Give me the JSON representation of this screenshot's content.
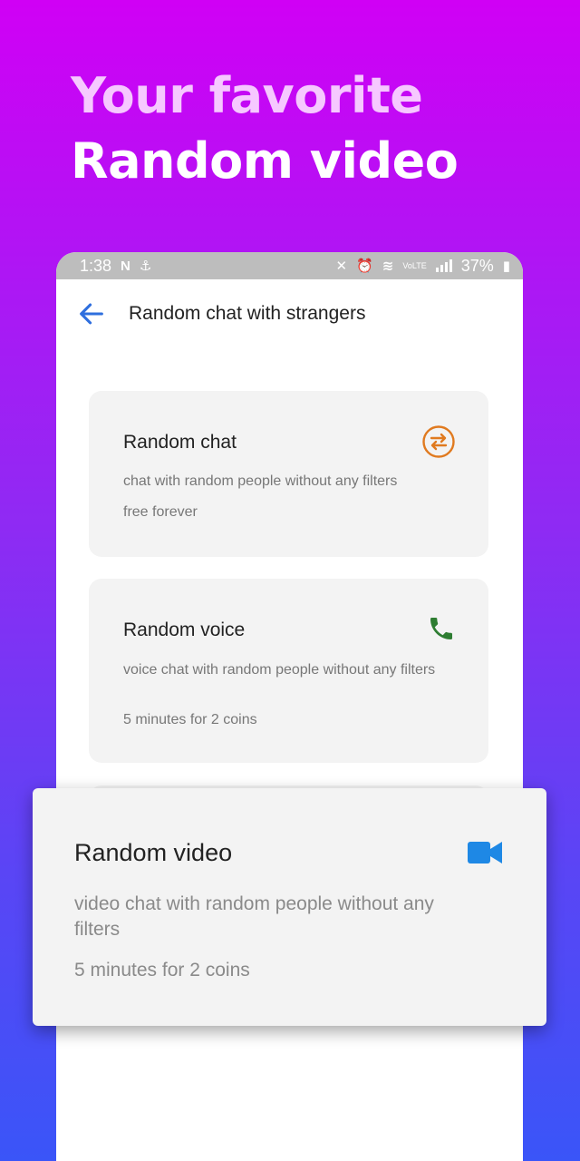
{
  "promo": {
    "line1": "Your favorite",
    "line2": "Random video"
  },
  "status_bar": {
    "time": "1:38",
    "network": "VoLTE",
    "battery": "37%"
  },
  "app_bar": {
    "title": "Random chat with strangers"
  },
  "cards": [
    {
      "title": "Random chat",
      "description": "chat with random people without any filters",
      "price": "free forever",
      "icon": "swap-icon",
      "icon_color": "#e07a1f"
    },
    {
      "title": "Random voice",
      "description": "voice chat with random people without any filters",
      "price": "5 minutes for 2 coins",
      "icon": "phone-icon",
      "icon_color": "#2e7d32"
    },
    {
      "title": "Random video",
      "description": "video chat with random people without any filters",
      "price": "5 minutes for 2 coins",
      "icon": "video-camera-icon",
      "icon_color": "#1e88e5"
    }
  ]
}
